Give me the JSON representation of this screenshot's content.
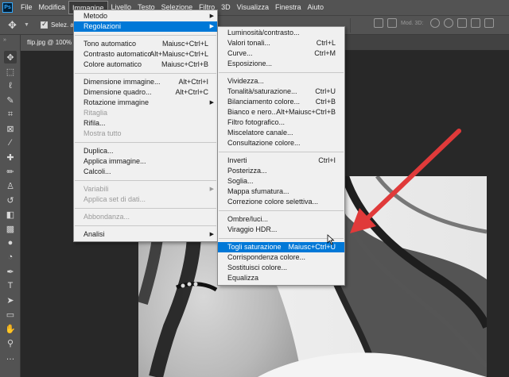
{
  "menubar": {
    "logo": "Ps",
    "items": [
      "File",
      "Modifica",
      "Immagine",
      "Livello",
      "Testo",
      "Selezione",
      "Filtro",
      "3D",
      "Visualizza",
      "Finestra",
      "Aiuto"
    ]
  },
  "options_bar": {
    "auto_select_label": "Selez. auto",
    "mode_3d_label": "Mod. 3D:"
  },
  "document_tab": {
    "title": "flip.jpg @ 100%"
  },
  "image_menu": {
    "items": [
      {
        "label": "Metodo",
        "submenu": true
      },
      {
        "label": "Regolazioni",
        "submenu": true,
        "highlighted": true
      },
      {
        "separator": true
      },
      {
        "label": "Tono automatico",
        "shortcut": "Maiusc+Ctrl+L"
      },
      {
        "label": "Contrasto automatico",
        "shortcut": "Alt+Maiusc+Ctrl+L"
      },
      {
        "label": "Colore automatico",
        "shortcut": "Maiusc+Ctrl+B"
      },
      {
        "separator": true
      },
      {
        "label": "Dimensione immagine...",
        "shortcut": "Alt+Ctrl+I"
      },
      {
        "label": "Dimensione quadro...",
        "shortcut": "Alt+Ctrl+C"
      },
      {
        "label": "Rotazione immagine",
        "submenu": true
      },
      {
        "label": "Ritaglia",
        "disabled": true
      },
      {
        "label": "Rifila..."
      },
      {
        "label": "Mostra tutto",
        "disabled": true
      },
      {
        "separator": true
      },
      {
        "label": "Duplica..."
      },
      {
        "label": "Applica immagine..."
      },
      {
        "label": "Calcoli..."
      },
      {
        "separator": true
      },
      {
        "label": "Variabili",
        "submenu": true,
        "disabled": true
      },
      {
        "label": "Applica set di dati...",
        "disabled": true
      },
      {
        "separator": true
      },
      {
        "label": "Abbondanza...",
        "disabled": true
      },
      {
        "separator": true
      },
      {
        "label": "Analisi",
        "submenu": true
      }
    ]
  },
  "adjustments_menu": {
    "items": [
      {
        "label": "Luminosità/contrasto..."
      },
      {
        "label": "Valori tonali...",
        "shortcut": "Ctrl+L"
      },
      {
        "label": "Curve...",
        "shortcut": "Ctrl+M"
      },
      {
        "label": "Esposizione..."
      },
      {
        "separator": true
      },
      {
        "label": "Vividezza..."
      },
      {
        "label": "Tonalità/saturazione...",
        "shortcut": "Ctrl+U"
      },
      {
        "label": "Bilanciamento colore...",
        "shortcut": "Ctrl+B"
      },
      {
        "label": "Bianco e nero...",
        "shortcut": "Alt+Maiusc+Ctrl+B"
      },
      {
        "label": "Filtro fotografico..."
      },
      {
        "label": "Miscelatore canale..."
      },
      {
        "label": "Consultazione colore..."
      },
      {
        "separator": true
      },
      {
        "label": "Inverti",
        "shortcut": "Ctrl+I"
      },
      {
        "label": "Posterizza..."
      },
      {
        "label": "Soglia..."
      },
      {
        "label": "Mappa sfumatura..."
      },
      {
        "label": "Correzione colore selettiva..."
      },
      {
        "separator": true
      },
      {
        "label": "Ombre/luci..."
      },
      {
        "label": "Viraggio HDR..."
      },
      {
        "separator": true
      },
      {
        "label": "Togli saturazione",
        "shortcut": "Maiusc+Ctrl+U",
        "highlighted": true
      },
      {
        "label": "Corrispondenza colore..."
      },
      {
        "label": "Sostituisci colore..."
      },
      {
        "label": "Equalizza"
      }
    ]
  },
  "tools": [
    "move-icon",
    "marquee-icon",
    "lasso-icon",
    "quick-select-icon",
    "crop-icon",
    "frame-icon",
    "eyedropper-icon",
    "healing-icon",
    "brush-icon",
    "clone-stamp-icon",
    "history-brush-icon",
    "eraser-icon",
    "gradient-icon",
    "blur-icon",
    "dodge-icon",
    "pen-icon",
    "type-icon",
    "path-select-icon",
    "rectangle-icon",
    "hand-icon",
    "zoom-icon"
  ],
  "colors": {
    "panel": "#535353",
    "workspace": "#282828",
    "menu_bg": "#f0f0f0",
    "highlight": "#0078d7",
    "annotation_arrow": "#e03a3a"
  }
}
